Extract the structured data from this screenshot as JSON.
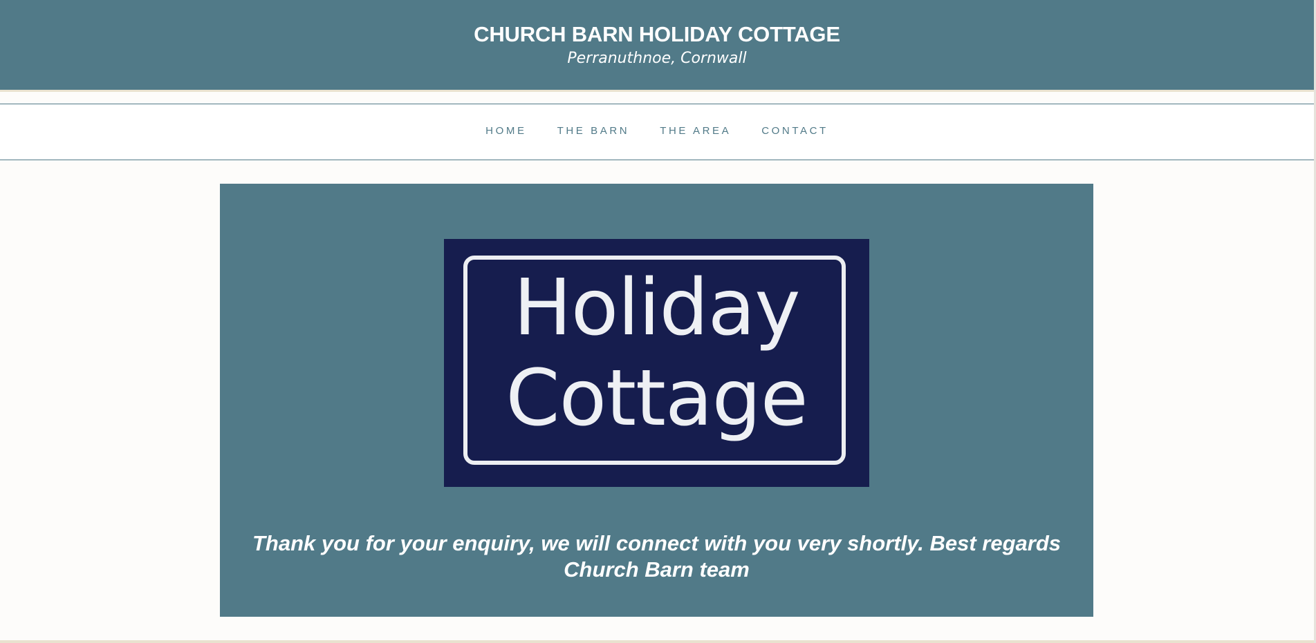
{
  "header": {
    "title": "CHURCH BARN HOLIDAY COTTAGE",
    "subtitle": "Perranuthnoe, Cornwall"
  },
  "nav": {
    "items": [
      {
        "label": "HOME"
      },
      {
        "label": "THE BARN"
      },
      {
        "label": "THE AREA"
      },
      {
        "label": "CONTACT"
      }
    ]
  },
  "main": {
    "logo": {
      "line1": "Holiday",
      "line2": "Cottage"
    },
    "message": "Thank you for your enquiry, we will connect with you very shortly. Best regards Church Barn team"
  },
  "colors": {
    "primary": "#517a88",
    "background": "#fdfcfa",
    "logo_bg": "#161d4e",
    "accent_rule": "#e9e2cf"
  }
}
